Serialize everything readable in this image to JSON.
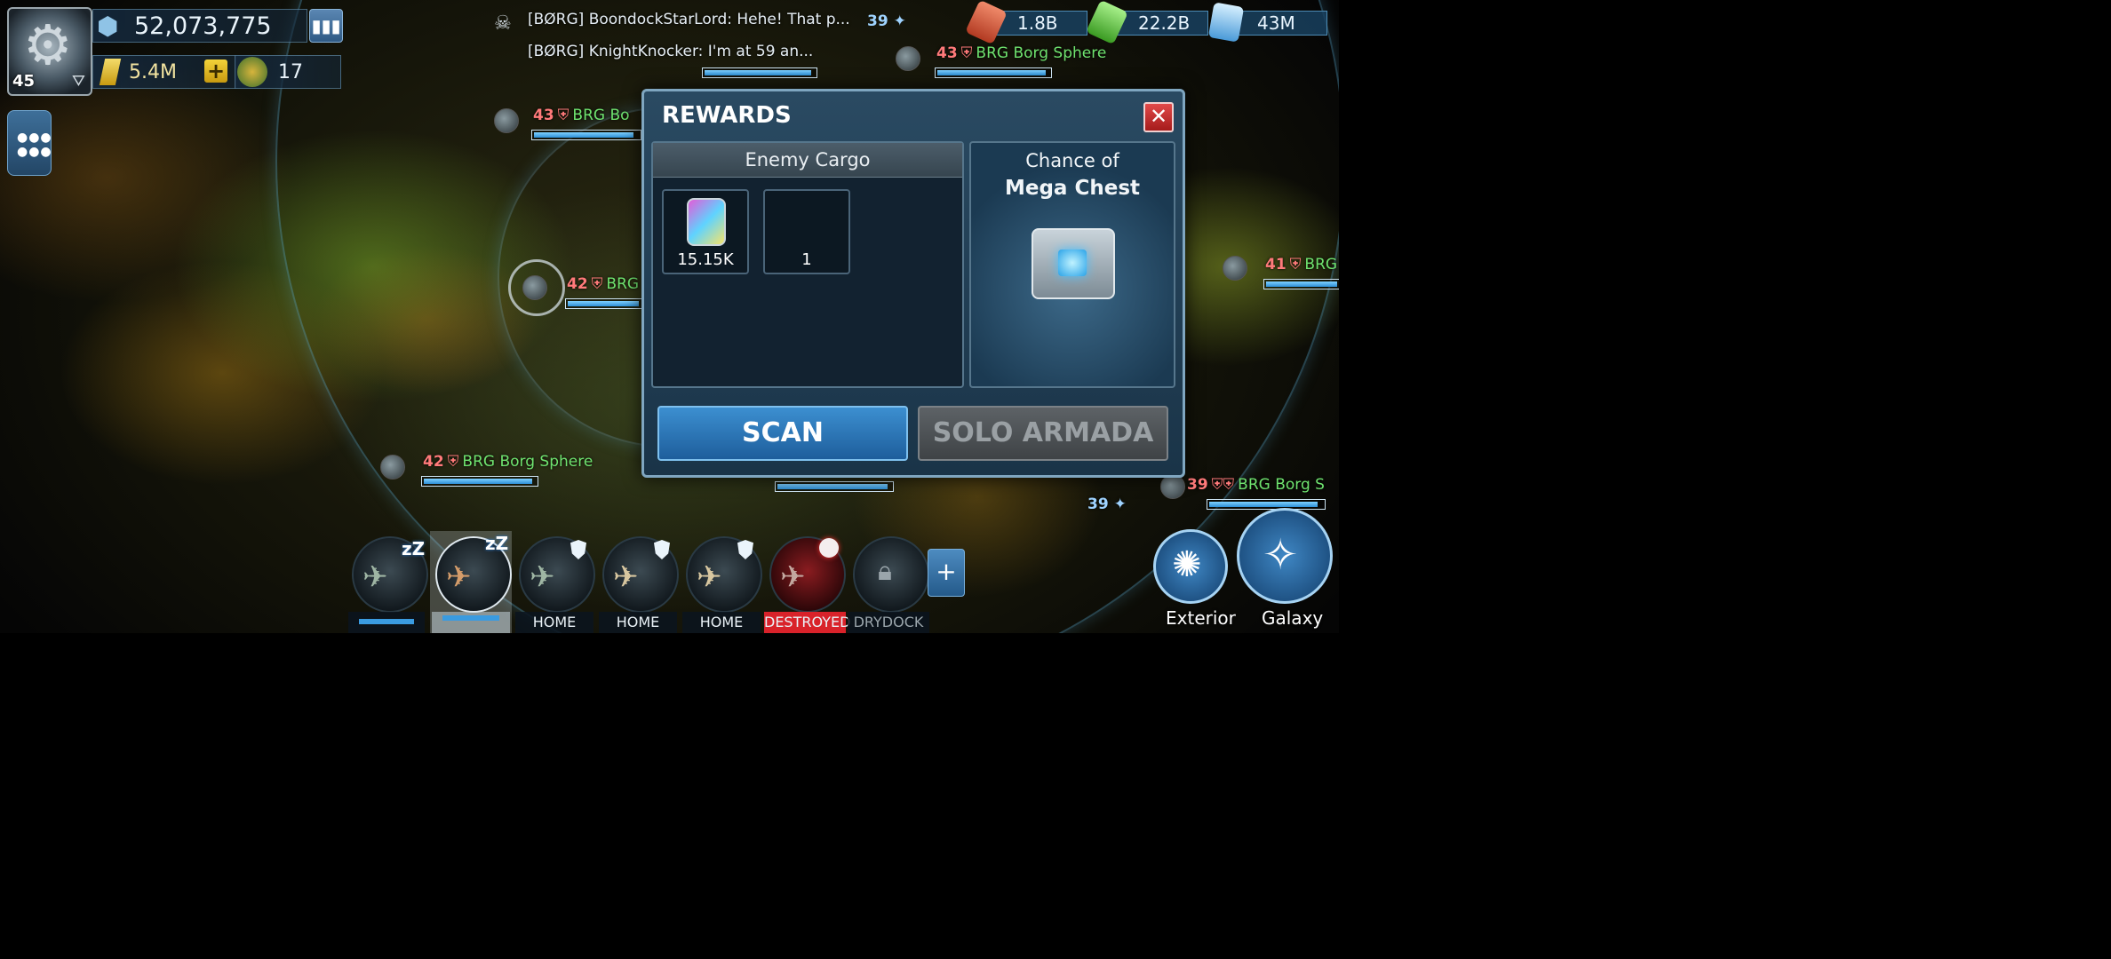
{
  "player": {
    "level": "45",
    "power": "52,073,775",
    "latinum": "5.4M",
    "alliance_count": "17"
  },
  "chat": {
    "line1": "[BØRG] BoondockStarLord: Hehe! That p...",
    "line2": "[BØRG] KnightKnocker: I'm at 59 an...",
    "unread": "39"
  },
  "resources": [
    {
      "name": "parsteel-icon",
      "value": "1.8B",
      "color": "#e0553a"
    },
    {
      "name": "tritanium-icon",
      "value": "22.2B",
      "color": "#5fd34a"
    },
    {
      "name": "dilithium-icon",
      "value": "43M",
      "color": "#7fc8ff"
    }
  ],
  "enemies": [
    {
      "level": "43",
      "name": "BRG Borg Sphere",
      "fill": 0.97
    },
    {
      "level": "43",
      "name": "BRG Bo",
      "fill": 0.95
    },
    {
      "level": "42",
      "name": "BRG",
      "fill": 0.95
    },
    {
      "level": "41",
      "name": "BRG",
      "fill": 0.95
    },
    {
      "level": "42",
      "name": "BRG Borg Sphere",
      "fill": 0.97
    },
    {
      "level": "39",
      "name": "BRG Borg S",
      "fill": 0.95
    },
    {
      "level": "",
      "name": "BRG Borg Sphere",
      "fill": 0.97
    }
  ],
  "badges": {
    "top": "39",
    "bottom": "39"
  },
  "rewards": {
    "title": "REWARDS",
    "cargo_title": "Enemy Cargo",
    "cargo_items": [
      {
        "value": "15.15K"
      },
      {
        "value": "1"
      }
    ],
    "chest_line1": "Chance of",
    "chest_line2": "Mega Chest",
    "scan_label": "SCAN",
    "solo_label": "SOLO ARMADA"
  },
  "ships": [
    {
      "status": "",
      "state": "sleeping"
    },
    {
      "status": "",
      "state": "sleeping-selected"
    },
    {
      "status": "HOME",
      "state": "shield"
    },
    {
      "status": "HOME",
      "state": "shield"
    },
    {
      "status": "HOME",
      "state": "shield"
    },
    {
      "status": "DESTROYED",
      "state": "destroyed"
    },
    {
      "status": "DRYDOCK F",
      "state": "locked"
    }
  ],
  "nav": {
    "exterior": "Exterior",
    "galaxy": "Galaxy"
  },
  "colors": {
    "accent_blue": "#2d8fd6",
    "enemy_level": "#ff7a7a",
    "enemy_name": "#6fe36f",
    "destroyed": "#d9222a"
  }
}
